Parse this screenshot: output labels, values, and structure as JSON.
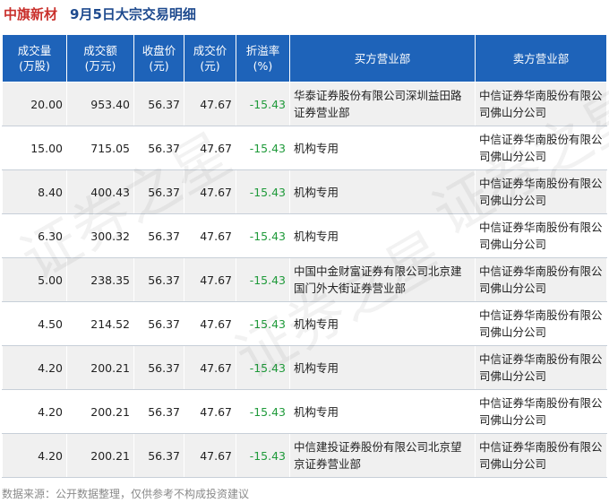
{
  "header": {
    "stock_name": "中旗新材",
    "title": "9月5日大宗交易明细"
  },
  "chart_data": {
    "type": "table",
    "columns": [
      [
        "成交量",
        "(万股)"
      ],
      [
        "成交额",
        "(万元)"
      ],
      [
        "收盘价",
        "(元)"
      ],
      [
        "成交价",
        "(元)"
      ],
      [
        "折溢率",
        "(%)"
      ],
      [
        "买方营业部"
      ],
      [
        "卖方营业部"
      ]
    ],
    "rows": [
      [
        "20.00",
        "953.40",
        "56.37",
        "47.67",
        "-15.43",
        "华泰证券股份有限公司深圳益田路证券营业部",
        "中信证券华南股份有限公司佛山分公司"
      ],
      [
        "15.00",
        "715.05",
        "56.37",
        "47.67",
        "-15.43",
        "机构专用",
        "中信证券华南股份有限公司佛山分公司"
      ],
      [
        "8.40",
        "400.43",
        "56.37",
        "47.67",
        "-15.43",
        "机构专用",
        "中信证券华南股份有限公司佛山分公司"
      ],
      [
        "6.30",
        "300.32",
        "56.37",
        "47.67",
        "-15.43",
        "机构专用",
        "中信证券华南股份有限公司佛山分公司"
      ],
      [
        "5.00",
        "238.35",
        "56.37",
        "47.67",
        "-15.43",
        "中国中金财富证券有限公司北京建国门外大街证券营业部",
        "中信证券华南股份有限公司佛山分公司"
      ],
      [
        "4.50",
        "214.52",
        "56.37",
        "47.67",
        "-15.43",
        "机构专用",
        "中信证券华南股份有限公司佛山分公司"
      ],
      [
        "4.20",
        "200.21",
        "56.37",
        "47.67",
        "-15.43",
        "机构专用",
        "中信证券华南股份有限公司佛山分公司"
      ],
      [
        "4.20",
        "200.21",
        "56.37",
        "47.67",
        "-15.43",
        "机构专用",
        "中信证券华南股份有限公司佛山分公司"
      ],
      [
        "4.20",
        "200.21",
        "56.37",
        "47.67",
        "-15.43",
        "中信建投证券股份有限公司北京望京证券营业部",
        "中信证券华南股份有限公司佛山分公司"
      ]
    ]
  },
  "watermark_texts": [
    "证券之星",
    "证券之星",
    "证券之星"
  ],
  "footer": "数据来源：公开数据整理，仅供参考不构成投资建议",
  "colors": {
    "header_bg": "#1e63b9",
    "discount": "#1f9a3a",
    "stock_name": "#c9302c",
    "title": "#1e4a8e"
  }
}
